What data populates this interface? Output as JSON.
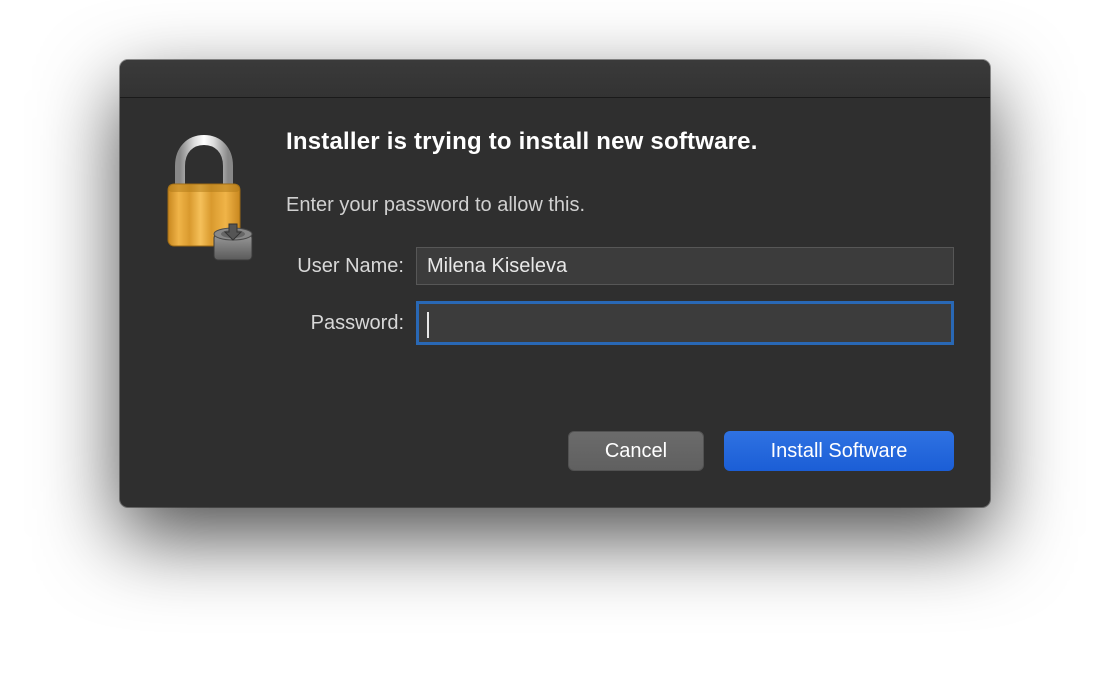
{
  "dialog": {
    "heading": "Installer is trying to install new software.",
    "subtext": "Enter your password to allow this.",
    "username_label": "User Name:",
    "password_label": "Password:",
    "username_value": "Milena Kiseleva",
    "password_value": "",
    "cancel_label": "Cancel",
    "install_label": "Install Software"
  },
  "colors": {
    "dialog_bg": "#2f2f2f",
    "primary_button": "#2063db",
    "focus_ring": "#2968b5"
  }
}
